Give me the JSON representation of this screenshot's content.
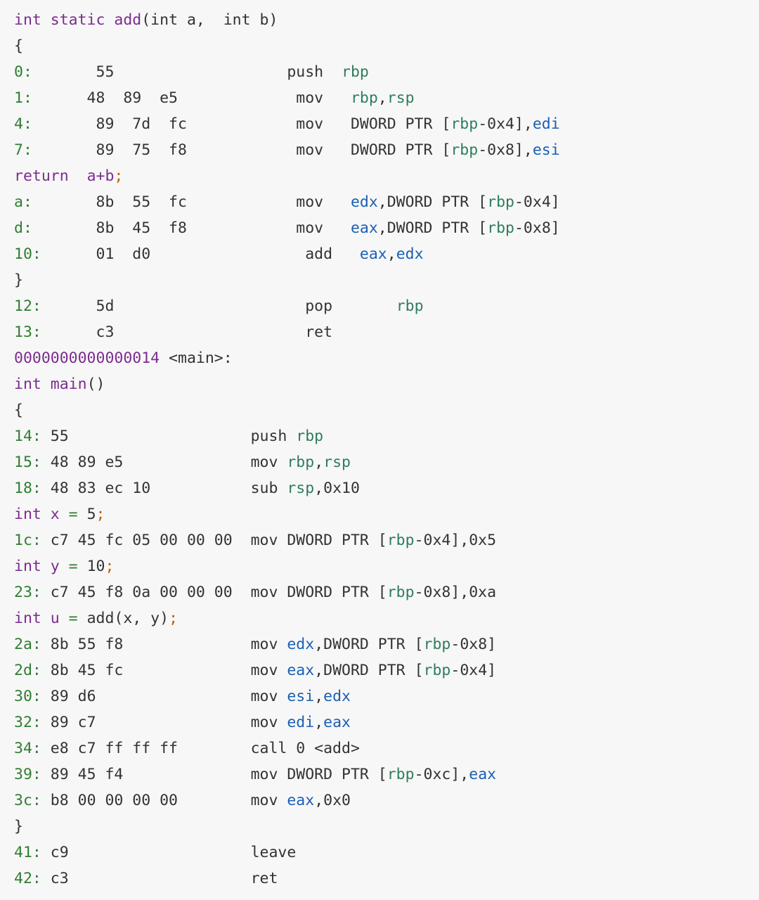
{
  "document": {
    "title": "Disassembly Listing",
    "background_color": "#f7f7f7",
    "palette": {
      "keyword_purple": "#7b2d8e",
      "address_green": "#2f7d32",
      "register64_green": "#2e7d5b",
      "register32_blue": "#1a5fb4",
      "plain_text": "#333333",
      "semicolon_orange": "#c06000",
      "operator_green": "#2f7d32"
    }
  },
  "lines": [
    {
      "kind": "source",
      "tokens": [
        {
          "t": "int static ",
          "c": "kw"
        },
        {
          "t": "add",
          "c": "kw"
        },
        {
          "t": "(int a,  int b)",
          "c": "plain"
        }
      ]
    },
    {
      "kind": "source",
      "tokens": [
        {
          "t": "{",
          "c": "plain"
        }
      ]
    },
    {
      "kind": "asm",
      "tokens": [
        {
          "t": "0:",
          "c": "addr"
        },
        {
          "t": "       55                   ",
          "c": "plain"
        },
        {
          "t": "push  ",
          "c": "plain"
        },
        {
          "t": "rbp",
          "c": "reg64"
        }
      ]
    },
    {
      "kind": "asm",
      "tokens": [
        {
          "t": "1:",
          "c": "addr"
        },
        {
          "t": "      48  89  e5             ",
          "c": "plain"
        },
        {
          "t": "mov   ",
          "c": "plain"
        },
        {
          "t": "rbp",
          "c": "reg64"
        },
        {
          "t": ",",
          "c": "plain"
        },
        {
          "t": "rsp",
          "c": "reg64"
        }
      ]
    },
    {
      "kind": "asm",
      "tokens": [
        {
          "t": "4:",
          "c": "addr"
        },
        {
          "t": "       89  7d  fc            ",
          "c": "plain"
        },
        {
          "t": "mov   ",
          "c": "plain"
        },
        {
          "t": "DWORD PTR [",
          "c": "plain"
        },
        {
          "t": "rbp",
          "c": "reg64"
        },
        {
          "t": "-0x4],",
          "c": "plain"
        },
        {
          "t": "edi",
          "c": "reg32"
        }
      ]
    },
    {
      "kind": "asm",
      "tokens": [
        {
          "t": "7:",
          "c": "addr"
        },
        {
          "t": "       89  75  f8            ",
          "c": "plain"
        },
        {
          "t": "mov   ",
          "c": "plain"
        },
        {
          "t": "DWORD PTR [",
          "c": "plain"
        },
        {
          "t": "rbp",
          "c": "reg64"
        },
        {
          "t": "-0x8],",
          "c": "plain"
        },
        {
          "t": "esi",
          "c": "reg32"
        }
      ]
    },
    {
      "kind": "source",
      "tokens": [
        {
          "t": "return",
          "c": "kw"
        },
        {
          "t": "  ",
          "c": "plain"
        },
        {
          "t": "a+b",
          "c": "kw"
        },
        {
          "t": ";",
          "c": "semi"
        }
      ]
    },
    {
      "kind": "asm",
      "tokens": [
        {
          "t": "a:",
          "c": "addr"
        },
        {
          "t": "       8b  55  fc            ",
          "c": "plain"
        },
        {
          "t": "mov   ",
          "c": "plain"
        },
        {
          "t": "edx",
          "c": "reg32"
        },
        {
          "t": ",DWORD PTR [",
          "c": "plain"
        },
        {
          "t": "rbp",
          "c": "reg64"
        },
        {
          "t": "-0x4]",
          "c": "plain"
        }
      ]
    },
    {
      "kind": "asm",
      "tokens": [
        {
          "t": "d:",
          "c": "addr"
        },
        {
          "t": "       8b  45  f8            ",
          "c": "plain"
        },
        {
          "t": "mov   ",
          "c": "plain"
        },
        {
          "t": "eax",
          "c": "reg32"
        },
        {
          "t": ",DWORD PTR [",
          "c": "plain"
        },
        {
          "t": "rbp",
          "c": "reg64"
        },
        {
          "t": "-0x8]",
          "c": "plain"
        }
      ]
    },
    {
      "kind": "asm",
      "tokens": [
        {
          "t": "10:",
          "c": "addr"
        },
        {
          "t": "      01  d0                 ",
          "c": "plain"
        },
        {
          "t": "add   ",
          "c": "plain"
        },
        {
          "t": "eax",
          "c": "reg32"
        },
        {
          "t": ",",
          "c": "plain"
        },
        {
          "t": "edx",
          "c": "reg32"
        }
      ]
    },
    {
      "kind": "source",
      "tokens": [
        {
          "t": "}",
          "c": "plain"
        }
      ]
    },
    {
      "kind": "asm",
      "tokens": [
        {
          "t": "12:",
          "c": "addr"
        },
        {
          "t": "      5d                     ",
          "c": "plain"
        },
        {
          "t": "pop       ",
          "c": "plain"
        },
        {
          "t": "rbp",
          "c": "reg64"
        }
      ]
    },
    {
      "kind": "asm",
      "tokens": [
        {
          "t": "13:",
          "c": "addr"
        },
        {
          "t": "      c3                     ",
          "c": "plain"
        },
        {
          "t": "ret",
          "c": "plain"
        }
      ]
    },
    {
      "kind": "symbol",
      "tokens": [
        {
          "t": "0000000000000014",
          "c": "kw"
        },
        {
          "t": " <main>:",
          "c": "plain"
        }
      ]
    },
    {
      "kind": "source",
      "tokens": [
        {
          "t": "int main",
          "c": "kw"
        },
        {
          "t": "()",
          "c": "plain"
        }
      ]
    },
    {
      "kind": "source",
      "tokens": [
        {
          "t": "{",
          "c": "plain"
        }
      ]
    },
    {
      "kind": "asm",
      "tokens": [
        {
          "t": "14:",
          "c": "addr"
        },
        {
          "t": " 55                    ",
          "c": "plain"
        },
        {
          "t": "push ",
          "c": "plain"
        },
        {
          "t": "rbp",
          "c": "reg64"
        }
      ]
    },
    {
      "kind": "asm",
      "tokens": [
        {
          "t": "15:",
          "c": "addr"
        },
        {
          "t": " 48 89 e5              ",
          "c": "plain"
        },
        {
          "t": "mov ",
          "c": "plain"
        },
        {
          "t": "rbp",
          "c": "reg64"
        },
        {
          "t": ",",
          "c": "plain"
        },
        {
          "t": "rsp",
          "c": "reg64"
        }
      ]
    },
    {
      "kind": "asm",
      "tokens": [
        {
          "t": "18:",
          "c": "addr"
        },
        {
          "t": " 48 83 ec 10           ",
          "c": "plain"
        },
        {
          "t": "sub ",
          "c": "plain"
        },
        {
          "t": "rsp",
          "c": "reg64"
        },
        {
          "t": ",0x10",
          "c": "plain"
        }
      ]
    },
    {
      "kind": "source",
      "tokens": [
        {
          "t": "int x ",
          "c": "kw"
        },
        {
          "t": "=",
          "c": "op"
        },
        {
          "t": " 5",
          "c": "plain"
        },
        {
          "t": ";",
          "c": "semi"
        }
      ]
    },
    {
      "kind": "asm",
      "tokens": [
        {
          "t": "1c:",
          "c": "addr"
        },
        {
          "t": " c7 45 fc 05 00 00 00  ",
          "c": "plain"
        },
        {
          "t": "mov DWORD PTR [",
          "c": "plain"
        },
        {
          "t": "rbp",
          "c": "reg64"
        },
        {
          "t": "-0x4],0x5",
          "c": "plain"
        }
      ]
    },
    {
      "kind": "source",
      "tokens": [
        {
          "t": "int y ",
          "c": "kw"
        },
        {
          "t": "=",
          "c": "op"
        },
        {
          "t": " 10",
          "c": "plain"
        },
        {
          "t": ";",
          "c": "semi"
        }
      ]
    },
    {
      "kind": "asm",
      "tokens": [
        {
          "t": "23:",
          "c": "addr"
        },
        {
          "t": " c7 45 f8 0a 00 00 00  ",
          "c": "plain"
        },
        {
          "t": "mov DWORD PTR [",
          "c": "plain"
        },
        {
          "t": "rbp",
          "c": "reg64"
        },
        {
          "t": "-0x8],0xa",
          "c": "plain"
        }
      ]
    },
    {
      "kind": "source",
      "tokens": [
        {
          "t": "int u ",
          "c": "kw"
        },
        {
          "t": "=",
          "c": "op"
        },
        {
          "t": " add(x, y)",
          "c": "plain"
        },
        {
          "t": ";",
          "c": "semi"
        }
      ]
    },
    {
      "kind": "asm",
      "tokens": [
        {
          "t": "2a:",
          "c": "addr"
        },
        {
          "t": " 8b 55 f8              ",
          "c": "plain"
        },
        {
          "t": "mov ",
          "c": "plain"
        },
        {
          "t": "edx",
          "c": "reg32"
        },
        {
          "t": ",DWORD PTR [",
          "c": "plain"
        },
        {
          "t": "rbp",
          "c": "reg64"
        },
        {
          "t": "-0x8]",
          "c": "plain"
        }
      ]
    },
    {
      "kind": "asm",
      "tokens": [
        {
          "t": "2d:",
          "c": "addr"
        },
        {
          "t": " 8b 45 fc              ",
          "c": "plain"
        },
        {
          "t": "mov ",
          "c": "plain"
        },
        {
          "t": "eax",
          "c": "reg32"
        },
        {
          "t": ",DWORD PTR [",
          "c": "plain"
        },
        {
          "t": "rbp",
          "c": "reg64"
        },
        {
          "t": "-0x4]",
          "c": "plain"
        }
      ]
    },
    {
      "kind": "asm",
      "tokens": [
        {
          "t": "30:",
          "c": "addr"
        },
        {
          "t": " 89 d6                 ",
          "c": "plain"
        },
        {
          "t": "mov ",
          "c": "plain"
        },
        {
          "t": "esi",
          "c": "reg32"
        },
        {
          "t": ",",
          "c": "plain"
        },
        {
          "t": "edx",
          "c": "reg32"
        }
      ]
    },
    {
      "kind": "asm",
      "tokens": [
        {
          "t": "32:",
          "c": "addr"
        },
        {
          "t": " 89 c7                 ",
          "c": "plain"
        },
        {
          "t": "mov ",
          "c": "plain"
        },
        {
          "t": "edi",
          "c": "reg32"
        },
        {
          "t": ",",
          "c": "plain"
        },
        {
          "t": "eax",
          "c": "reg32"
        }
      ]
    },
    {
      "kind": "asm",
      "tokens": [
        {
          "t": "34:",
          "c": "addr"
        },
        {
          "t": " e8 c7 ff ff ff        ",
          "c": "plain"
        },
        {
          "t": "call 0 <add>",
          "c": "plain"
        }
      ]
    },
    {
      "kind": "asm",
      "tokens": [
        {
          "t": "39:",
          "c": "addr"
        },
        {
          "t": " 89 45 f4              ",
          "c": "plain"
        },
        {
          "t": "mov DWORD PTR [",
          "c": "plain"
        },
        {
          "t": "rbp",
          "c": "reg64"
        },
        {
          "t": "-0xc],",
          "c": "plain"
        },
        {
          "t": "eax",
          "c": "reg32"
        }
      ]
    },
    {
      "kind": "asm",
      "tokens": [
        {
          "t": "3c:",
          "c": "addr"
        },
        {
          "t": " b8 00 00 00 00        ",
          "c": "plain"
        },
        {
          "t": "mov ",
          "c": "plain"
        },
        {
          "t": "eax",
          "c": "reg32"
        },
        {
          "t": ",0x0",
          "c": "plain"
        }
      ]
    },
    {
      "kind": "source",
      "tokens": [
        {
          "t": "}",
          "c": "plain"
        }
      ]
    },
    {
      "kind": "asm",
      "tokens": [
        {
          "t": "41:",
          "c": "addr"
        },
        {
          "t": " c9                    ",
          "c": "plain"
        },
        {
          "t": "leave",
          "c": "plain"
        }
      ]
    },
    {
      "kind": "asm",
      "tokens": [
        {
          "t": "42:",
          "c": "addr"
        },
        {
          "t": " c3                    ",
          "c": "plain"
        },
        {
          "t": "ret",
          "c": "plain"
        }
      ]
    }
  ]
}
